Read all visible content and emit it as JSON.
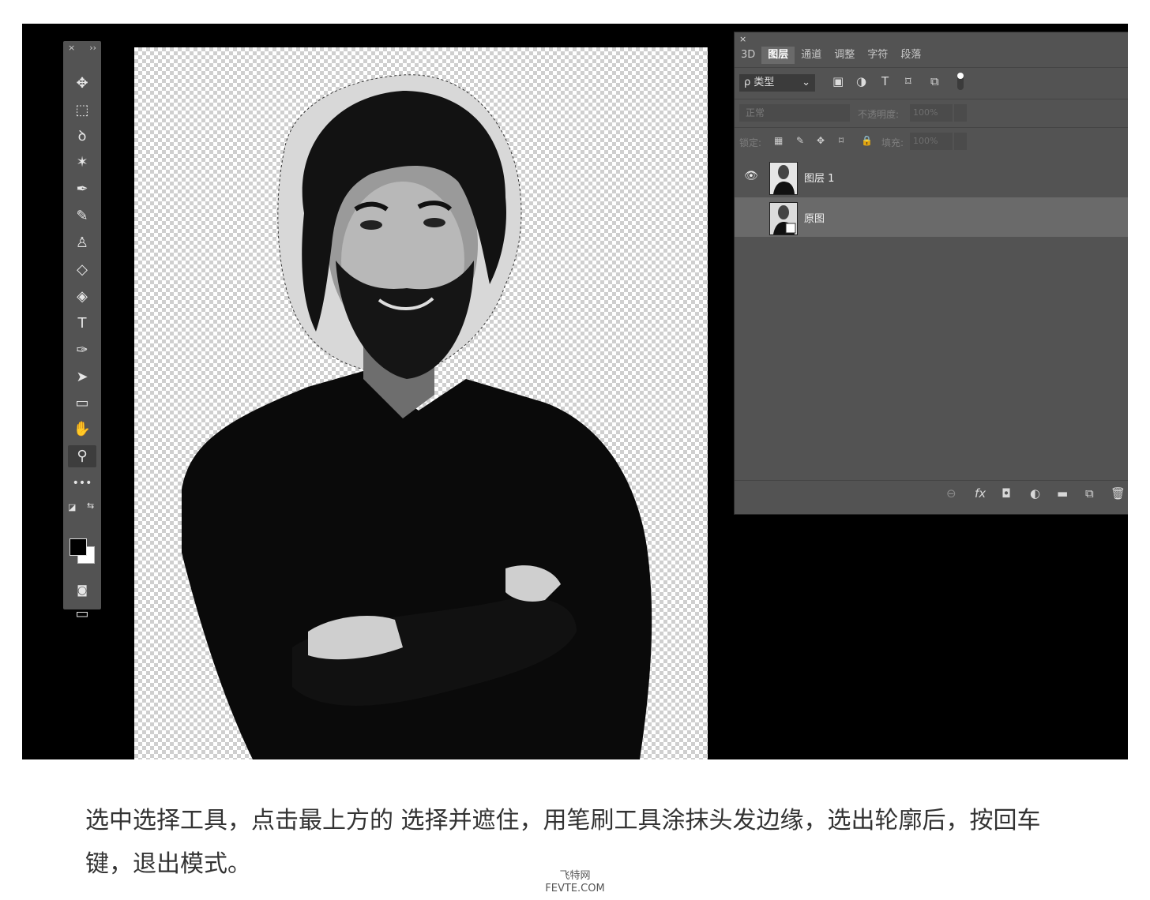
{
  "toolbar": {
    "header_close": "×",
    "header_collapse": "››",
    "tools": [
      {
        "name": "move-tool",
        "glyph": "✥"
      },
      {
        "name": "marquee-tool",
        "glyph": "⬚"
      },
      {
        "name": "lasso-tool",
        "glyph": "ꝺ"
      },
      {
        "name": "magic-wand-tool",
        "glyph": "✶"
      },
      {
        "name": "eyedropper-tool",
        "glyph": "✒"
      },
      {
        "name": "brush-tool",
        "glyph": "✎"
      },
      {
        "name": "stamp-tool",
        "glyph": "♙"
      },
      {
        "name": "eraser-tool",
        "glyph": "◇"
      },
      {
        "name": "paint-bucket-tool",
        "glyph": "◈"
      },
      {
        "name": "type-tool",
        "glyph": "T"
      },
      {
        "name": "pen-tool",
        "glyph": "✑"
      },
      {
        "name": "path-selection-tool",
        "glyph": "➤"
      },
      {
        "name": "rectangle-tool",
        "glyph": "▭"
      },
      {
        "name": "hand-tool",
        "glyph": "✋"
      },
      {
        "name": "zoom-tool",
        "glyph": "⚲"
      },
      {
        "name": "more-tools",
        "glyph": "•••"
      }
    ],
    "quick_mask_glyph": "◙",
    "screen_mode_glyph": "▭"
  },
  "panel": {
    "close": "×",
    "tabs": [
      "3D",
      "图层",
      "通道",
      "调整",
      "字符",
      "段落"
    ],
    "active_tab": "图层",
    "filter_label": "ρ 类型",
    "filter_chevron": "⌄",
    "filter_icons": [
      "▣",
      "◑",
      "T",
      "⌑",
      "⧉"
    ],
    "blend_mode": "正常",
    "opacity_label": "不透明度:",
    "opacity_value": "100%",
    "lock_label": "锁定:",
    "lock_icons": [
      "▦",
      "✎",
      "✥",
      "⌑",
      "🔒"
    ],
    "fill_label": "填充:",
    "fill_value": "100%",
    "layers": [
      {
        "name": "图层 1",
        "visible": true,
        "selected": false
      },
      {
        "name": "原图",
        "visible": false,
        "selected": true
      }
    ],
    "bottom_icons": [
      "⊖",
      "fx",
      "◘",
      "◐",
      "▬",
      "⧉",
      "🗑"
    ]
  },
  "caption": {
    "text": "选中选择工具，点击最上方的 选择并遮住，用笔刷工具涂抹头发边缘，选出轮廓后，按回车键，退出模式。"
  },
  "watermark": {
    "line1": "飞特网",
    "line2": "FEVTE.COM"
  }
}
